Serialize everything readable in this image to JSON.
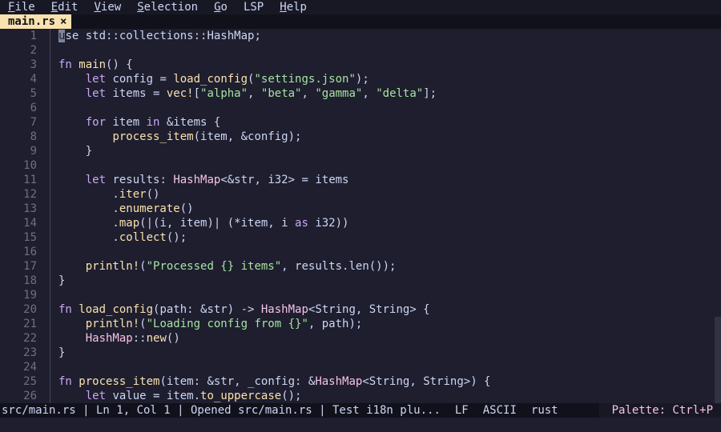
{
  "menu": [
    {
      "label": "File",
      "mnemonic": "F",
      "rest": "ile"
    },
    {
      "label": "Edit",
      "mnemonic": "E",
      "rest": "dit"
    },
    {
      "label": "View",
      "mnemonic": "V",
      "rest": "iew"
    },
    {
      "label": "Selection",
      "mnemonic": "S",
      "rest": "election"
    },
    {
      "label": "Go",
      "mnemonic": "G",
      "rest": "o"
    },
    {
      "label": "LSP",
      "mnemonic": "",
      "rest": "LSP"
    },
    {
      "label": "Help",
      "mnemonic": "H",
      "rest": "elp"
    }
  ],
  "tab": {
    "filename": "main.rs",
    "close": "×"
  },
  "lines": [
    "1",
    "2",
    "3",
    "4",
    "5",
    "6",
    "7",
    "8",
    "9",
    "10",
    "11",
    "12",
    "13",
    "14",
    "15",
    "16",
    "17",
    "18",
    "19",
    "20",
    "21",
    "22",
    "23",
    "24",
    "25",
    "26"
  ],
  "status": {
    "info": "src/main.rs | Ln 1, Col 1 | Opened src/main.rs | Test i18n plu...",
    "line_ending": "LF",
    "encoding": "ASCII",
    "language": "rust",
    "palette": "Palette: Ctrl+P"
  },
  "colors": {
    "background": "#1e1e2e",
    "keyword": "#cba6f7",
    "function": "#f9e2af",
    "string": "#a6e3a1",
    "type": "#f5c2e7",
    "tab_active": "#f9e2af"
  }
}
